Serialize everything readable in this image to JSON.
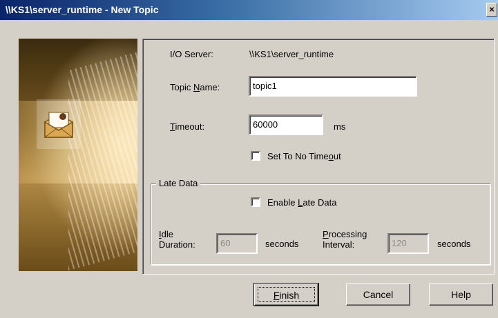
{
  "window": {
    "title": "\\\\KS1\\server_runtime - New Topic",
    "close_glyph": "×"
  },
  "form": {
    "io_server_label": "I/O Server:",
    "io_server_value": "\\\\KS1\\server_runtime",
    "topic_name_label_prefix": "Topic ",
    "topic_name_label_underlined": "N",
    "topic_name_label_suffix": "ame:",
    "topic_name_value": "topic1",
    "timeout_label_underlined": "T",
    "timeout_label_suffix": "imeout:",
    "timeout_value": "60000",
    "timeout_unit": "ms",
    "no_timeout_prefix": "Set To No Time",
    "no_timeout_underlined": "o",
    "no_timeout_suffix": "ut",
    "no_timeout_checked": false
  },
  "late_data": {
    "group_label": "Late Data",
    "enable_prefix": "Enable ",
    "enable_underlined": "L",
    "enable_suffix": "ate Data",
    "enable_checked": false,
    "idle_label_underlined": "I",
    "idle_label_line1_suffix": "dle",
    "idle_label_line2": "Duration:",
    "idle_value": "60",
    "idle_unit": "seconds",
    "processing_label_underlined": "P",
    "processing_label_line1_suffix": "rocessing",
    "processing_label_line2": "Interval:",
    "processing_value": "120",
    "processing_unit": "seconds"
  },
  "buttons": {
    "finish_underlined": "F",
    "finish_suffix": "inish",
    "cancel": "Cancel",
    "help": "Help"
  },
  "icons": {
    "side_image": "open-envelope-icon"
  }
}
